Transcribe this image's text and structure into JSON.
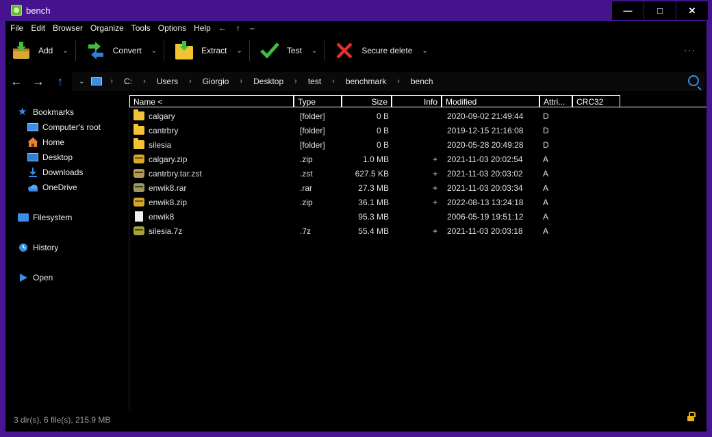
{
  "window": {
    "title": "bench",
    "min_label": "—",
    "max_label": "□",
    "close_label": "✕"
  },
  "menu": {
    "items": [
      "File",
      "Edit",
      "Browser",
      "Organize",
      "Tools",
      "Options",
      "Help"
    ],
    "arrows": [
      "←",
      "↑",
      "–"
    ]
  },
  "toolbar": {
    "add": "Add",
    "convert": "Convert",
    "extract": "Extract",
    "test": "Test",
    "secure_delete": "Secure delete",
    "more": "···"
  },
  "nav": {
    "back": "←",
    "forward": "→",
    "up": "↑",
    "crumbs": [
      "C:",
      "Users",
      "Giorgio",
      "Desktop",
      "test",
      "benchmark",
      "bench"
    ]
  },
  "sidebar": {
    "bookmarks": "Bookmarks",
    "items": [
      "Computer's root",
      "Home",
      "Desktop",
      "Downloads",
      "OneDrive"
    ],
    "filesystem": "Filesystem",
    "history": "History",
    "open": "Open"
  },
  "columns": [
    "Name <",
    "Type",
    "Size",
    "Info",
    "Modified",
    "Attri...",
    "CRC32"
  ],
  "files": [
    {
      "name": "calgary",
      "type": "[folder]",
      "size": "0 B",
      "info": "",
      "modified": "2020-09-02 21:49:44",
      "attr": "D",
      "icon": "folder-icon"
    },
    {
      "name": "cantrbry",
      "type": "[folder]",
      "size": "0 B",
      "info": "",
      "modified": "2019-12-15 21:16:08",
      "attr": "D",
      "icon": "folder-icon"
    },
    {
      "name": "silesia",
      "type": "[folder]",
      "size": "0 B",
      "info": "",
      "modified": "2020-05-28 20:49:28",
      "attr": "D",
      "icon": "folder-icon"
    },
    {
      "name": "calgary.zip",
      "type": ".zip",
      "size": "1.0 MB",
      "info": "+",
      "modified": "2021-11-03 20:02:54",
      "attr": "A",
      "icon": "zip-archive-icon"
    },
    {
      "name": "cantrbry.tar.zst",
      "type": ".zst",
      "size": "627.5 KB",
      "info": "+",
      "modified": "2021-11-03 20:03:02",
      "attr": "A",
      "icon": "zst-archive-icon"
    },
    {
      "name": "enwik8.rar",
      "type": ".rar",
      "size": "27.3 MB",
      "info": "+",
      "modified": "2021-11-03 20:03:34",
      "attr": "A",
      "icon": "rar-archive-icon"
    },
    {
      "name": "enwik8.zip",
      "type": ".zip",
      "size": "36.1 MB",
      "info": "+",
      "modified": "2022-08-13 13:24:18",
      "attr": "A",
      "icon": "zip-archive-icon"
    },
    {
      "name": "enwik8",
      "type": "",
      "size": "95.3 MB",
      "info": "",
      "modified": "2006-05-19 19:51:12",
      "attr": "A",
      "icon": "file-icon"
    },
    {
      "name": "silesia.7z",
      "type": ".7z",
      "size": "55.4 MB",
      "info": "+",
      "modified": "2021-11-03 20:03:18",
      "attr": "A",
      "icon": "7z-archive-icon"
    }
  ],
  "status": {
    "summary": "3 dir(s), 6 file(s), 215.9 MB"
  },
  "colors": {
    "window_frame": "#4a1595",
    "background": "#000000",
    "accent": "#3a8ee6",
    "folder": "#f2c433"
  }
}
